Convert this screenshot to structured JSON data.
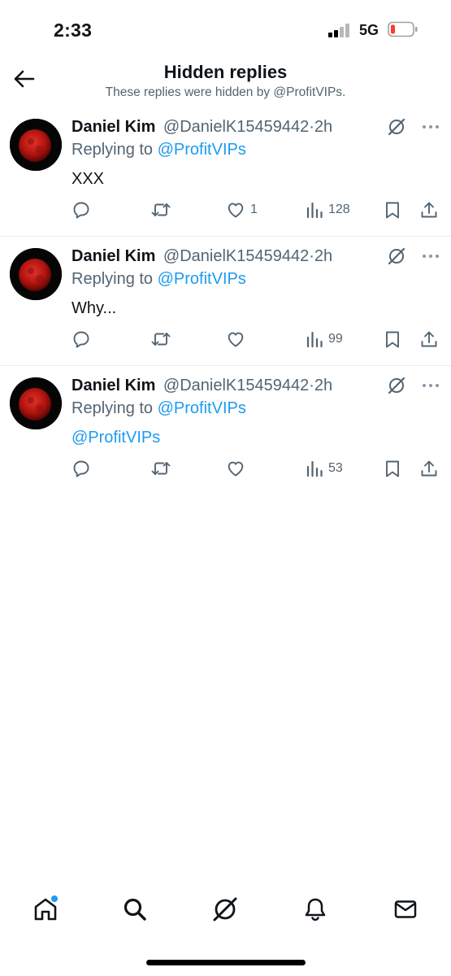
{
  "status_bar": {
    "time": "2:33",
    "network": "5G",
    "battery_level": 0.1,
    "battery_color": "#ff3b30"
  },
  "header": {
    "back_icon": "arrow-left-icon",
    "title": "Hidden replies",
    "subtitle": "These replies were hidden by @ProfitVIPs."
  },
  "tweets": [
    {
      "name": "Daniel Kim",
      "handle": "@DanielK15459442",
      "separator": "·",
      "time": "2h",
      "replying_prefix": "Replying to",
      "replying_to": "@ProfitVIPs",
      "text": "XXX",
      "likes": "1",
      "views": "128"
    },
    {
      "name": "Daniel Kim",
      "handle": "@DanielK15459442",
      "separator": "·",
      "time": "2h",
      "replying_prefix": "Replying to",
      "replying_to": "@ProfitVIPs",
      "text": "Why...",
      "likes": "",
      "views": "99"
    },
    {
      "name": "Daniel Kim",
      "handle": "@DanielK15459442",
      "separator": "·",
      "time": "2h",
      "replying_prefix": "Replying to",
      "replying_to": "@ProfitVIPs",
      "text": "@ProfitVIPs",
      "likes": "",
      "views": "53"
    }
  ],
  "bottom_nav": {
    "items": [
      "home-icon",
      "search-icon",
      "grok-icon",
      "notifications-bell-icon",
      "messages-envelope-icon"
    ],
    "home_has_notification_dot": true
  },
  "colors": {
    "accent": "#1d9bf0",
    "text_primary": "#0f1419",
    "text_secondary": "#536471",
    "divider": "#e6ecf0"
  }
}
